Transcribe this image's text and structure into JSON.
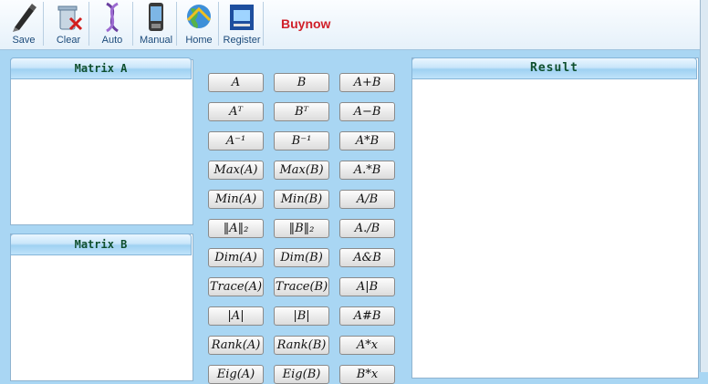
{
  "toolbar": {
    "save": "Save",
    "clear": "Clear",
    "auto": "Auto",
    "manual": "Manual",
    "home": "Home",
    "register": "Register",
    "buynow": "Buynow"
  },
  "panels": {
    "matrix_a": "Matrix A",
    "matrix_b": "Matrix B",
    "result": "Result"
  },
  "operations": [
    [
      "A",
      "B",
      "A+B"
    ],
    [
      "Aᵀ",
      "Bᵀ",
      "A−B"
    ],
    [
      "A⁻¹",
      "B⁻¹",
      "A*B"
    ],
    [
      "Max(A)",
      "Max(B)",
      "A.*B"
    ],
    [
      "Min(A)",
      "Min(B)",
      "A/B"
    ],
    [
      "‖A‖₂",
      "‖B‖₂",
      "A./B"
    ],
    [
      "Dim(A)",
      "Dim(B)",
      "A&B"
    ],
    [
      "Trace(A)",
      "Trace(B)",
      "A|B"
    ],
    [
      "|A|",
      "|B|",
      "A#B"
    ],
    [
      "Rank(A)",
      "Rank(B)",
      "A*x"
    ],
    [
      "Eig(A)",
      "Eig(B)",
      "B*x"
    ]
  ],
  "colors": {
    "background": "#a9d6f3",
    "buynow": "#d0202a",
    "panel_title": "#0e4f2e"
  }
}
